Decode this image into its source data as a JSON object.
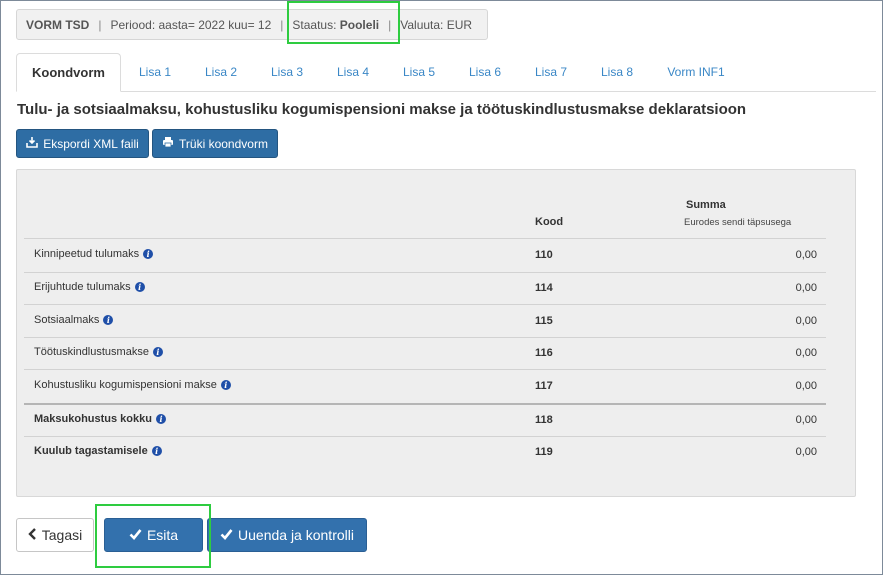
{
  "status_bar": {
    "form": "VORM TSD",
    "period": "Periood: aasta= 2022 kuu= 12",
    "status_label": "Staatus:",
    "status_value": "Pooleli",
    "currency": "Valuuta: EUR"
  },
  "tabs": [
    {
      "label": "Koondvorm",
      "active": true
    },
    {
      "label": "Lisa 1"
    },
    {
      "label": "Lisa 2"
    },
    {
      "label": "Lisa 3"
    },
    {
      "label": "Lisa 4"
    },
    {
      "label": "Lisa 5"
    },
    {
      "label": "Lisa 6"
    },
    {
      "label": "Lisa 7"
    },
    {
      "label": "Lisa 8"
    },
    {
      "label": "Vorm INF1"
    }
  ],
  "page_title": "Tulu- ja sotsiaalmaksu, kohustusliku kogumispensioni makse ja töötuskindlustusmakse deklaratsioon",
  "actions": {
    "export_xml": "Ekspordi XML faili",
    "print": "Trüki koondvorm"
  },
  "table": {
    "col_code": "Kood",
    "col_sum": "Summa",
    "col_sum_sub": "Eurodes sendi täpsusega",
    "rows": [
      {
        "label": "Kinnipeetud tulumaks",
        "code": "110",
        "sum": "0,00"
      },
      {
        "label": "Erijuhtude tulumaks",
        "code": "114",
        "sum": "0,00"
      },
      {
        "label": "Sotsiaalmaks",
        "code": "115",
        "sum": "0,00"
      },
      {
        "label": "Töötuskindlustusmakse",
        "code": "116",
        "sum": "0,00"
      },
      {
        "label": "Kohustusliku kogumispensioni makse",
        "code": "117",
        "sum": "0,00"
      },
      {
        "label": "Maksukohustus kokku",
        "code": "118",
        "sum": "0,00"
      },
      {
        "label": "Kuulub tagastamisele",
        "code": "119",
        "sum": "0,00"
      }
    ]
  },
  "footer": {
    "back": "Tagasi",
    "submit": "Esita",
    "refresh": "Uuenda ja kontrolli"
  },
  "icons": {
    "info": "info-icon",
    "export": "export-icon",
    "print": "printer-icon",
    "check": "check-icon",
    "back": "chevron-left-icon"
  },
  "colors": {
    "primary": "#2e6da4",
    "link": "#3a87c6",
    "highlight": "#2ecc40"
  }
}
